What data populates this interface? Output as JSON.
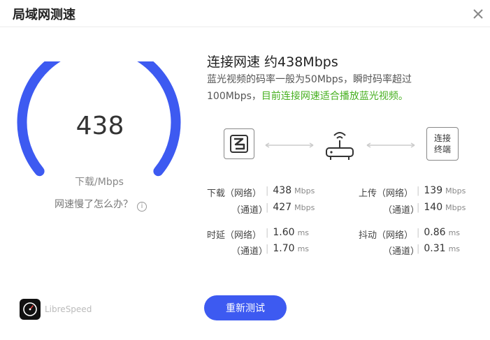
{
  "window": {
    "title": "局域网测速",
    "close_icon": "close-icon"
  },
  "gauge": {
    "value": "438",
    "unit": "下载/Mbps",
    "accent_color": "#3d5af1",
    "help_text": "网速慢了怎么办？",
    "help_icon_glyph": "i"
  },
  "result": {
    "headline": "连接网速 约438Mbps",
    "desc_part1": "蓝光视频的码率一般为50Mbps，瞬时码率超过100Mbps，",
    "desc_green": "目前连接网速适合播放蓝光视频。",
    "green_color": "#47b020"
  },
  "diagram": {
    "device_icon": "device-logo-icon",
    "router_icon": "router-wifi-icon",
    "terminal_line1": "连接",
    "terminal_line2": "终端"
  },
  "stats": {
    "download": {
      "label": "下载（网络）",
      "sub_label": "（通道）",
      "network": "438",
      "channel": "427",
      "unit": "Mbps"
    },
    "upload": {
      "label": "上传（网络）",
      "sub_label": "（通道）",
      "network": "139",
      "channel": "140",
      "unit": "Mbps"
    },
    "latency": {
      "label": "时延（网络）",
      "sub_label": "（通道）",
      "network": "1.60",
      "channel": "1.70",
      "unit": "ms"
    },
    "jitter": {
      "label": "抖动（网络）",
      "sub_label": "（通道）",
      "network": "0.86",
      "channel": "0.31",
      "unit": "ms"
    }
  },
  "footer": {
    "brand": "LibreSpeed",
    "brand_icon": "speedometer-logo-icon",
    "retest_label": "重新测试",
    "retest_color": "#3d5af1"
  }
}
